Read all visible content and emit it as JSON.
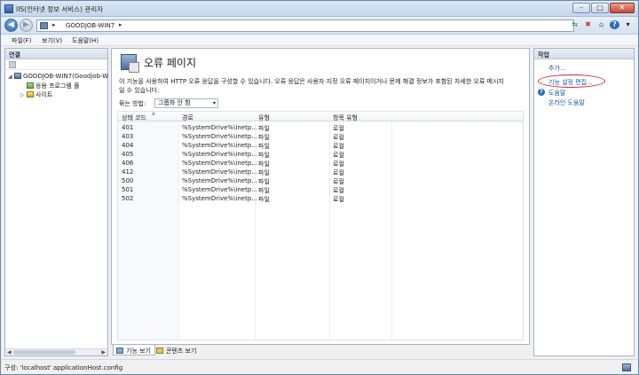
{
  "window": {
    "title": "IIS(인터넷 정보 서비스) 관리자",
    "buttons": {
      "minimize": "–",
      "maximize": "□",
      "close": "✕"
    }
  },
  "address": {
    "sep1": "▸",
    "server": "GOODJOB-WIN7",
    "sep2": "▸"
  },
  "menu": {
    "items": [
      "파일(F)",
      "보기(V)",
      "도움말(H)"
    ]
  },
  "left": {
    "header": "연결",
    "tree": [
      {
        "label": "GOODJOB-WIN7(Goodjob-W",
        "expander": "◢"
      },
      {
        "label": "응용 프로그램 풀",
        "expander": ""
      },
      {
        "label": "사이트",
        "expander": "▷"
      }
    ]
  },
  "center": {
    "title": "오류 페이지",
    "description": "이 기능을 사용하여 HTTP 오류 응답을 구성할 수 있습니다. 오류 응답은 사용자 지정 오류 페이지이거나 문제 해결 정보가 포함된 자세한 오류 메시지일 수 있습니다.",
    "group_by_label": "묶는 방법:",
    "group_by_value": "그룹화 안 함",
    "columns": [
      "상태 코드",
      "경로",
      "유형",
      "항목 유형"
    ],
    "rows": [
      {
        "code": "401",
        "path": "%SystemDrive%\\inetp...",
        "type": "파일",
        "entry": "로컬"
      },
      {
        "code": "403",
        "path": "%SystemDrive%\\inetp...",
        "type": "파일",
        "entry": "로컬"
      },
      {
        "code": "404",
        "path": "%SystemDrive%\\inetp...",
        "type": "파일",
        "entry": "로컬"
      },
      {
        "code": "405",
        "path": "%SystemDrive%\\inetp...",
        "type": "파일",
        "entry": "로컬"
      },
      {
        "code": "406",
        "path": "%SystemDrive%\\inetp...",
        "type": "파일",
        "entry": "로컬"
      },
      {
        "code": "412",
        "path": "%SystemDrive%\\inetp...",
        "type": "파일",
        "entry": "로컬"
      },
      {
        "code": "500",
        "path": "%SystemDrive%\\inetp...",
        "type": "파일",
        "entry": "로컬"
      },
      {
        "code": "501",
        "path": "%SystemDrive%\\inetp...",
        "type": "파일",
        "entry": "로컬"
      },
      {
        "code": "502",
        "path": "%SystemDrive%\\inetp...",
        "type": "파일",
        "entry": "로컬"
      }
    ],
    "tabs": [
      "기능 보기",
      "콘텐츠 보기"
    ]
  },
  "right": {
    "header": "작업",
    "actions": [
      "추가...",
      "기능 설정 편집...",
      "도움말",
      "온라인 도움말"
    ]
  },
  "status": {
    "text": "구성: 'localhost' applicationHost.config"
  }
}
